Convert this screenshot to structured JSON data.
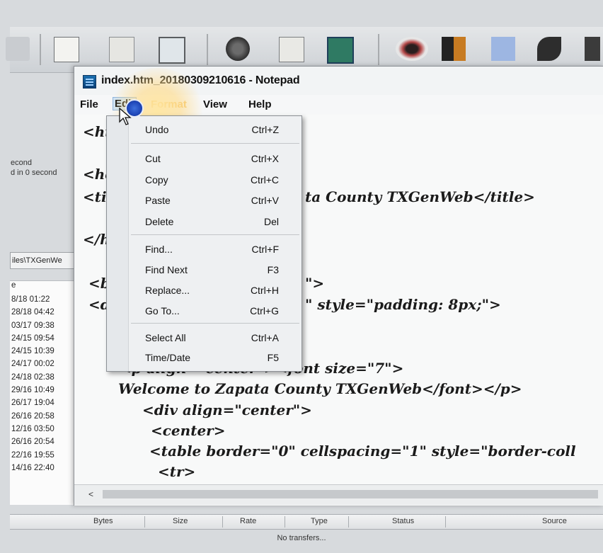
{
  "background_app": {
    "status_lines": [
      "econd",
      "d in 0 second"
    ],
    "path_text": "iles\\TXGenWe",
    "list_header": "e",
    "file_dates": [
      "8/18 01:22",
      "28/18 04:42",
      "03/17 09:38",
      "24/15 09:54",
      "24/15 10:39",
      "24/17 00:02",
      "24/18 02:38",
      "29/16 10:49",
      "26/17 19:04",
      "26/16 20:58",
      "12/16 03:50",
      "26/16 20:54",
      "22/16 19:55",
      "14/16 22:40"
    ],
    "transfer_columns": [
      "Bytes",
      "Size",
      "Rate",
      "Type",
      "Status",
      "Source"
    ],
    "no_transfers": "No transfers..."
  },
  "notepad": {
    "title": "index.htm_20180309210616 - Notepad",
    "menu": [
      "File",
      "Edit",
      "Format",
      "View",
      "Help"
    ],
    "code_lines": {
      "l1": "<ht",
      "l2": "<he",
      "l3a": "<ti",
      "l3b": "ta County TXGenWeb</title>",
      "l4": "</h",
      "l5a": "<bo",
      "l5b": "\">",
      "l6a": "<di",
      "l6b": "\" style=\"padding: 8px;\">",
      "l7": "<p align=\"center\"><font size=\"7\">",
      "l8": "Welcome to Zapata County TXGenWeb</font></p>",
      "l9": "<div align=\"center\">",
      "l10": "<center>",
      "l11": "<table border=\"0\" cellspacing=\"1\" style=\"border-coll",
      "l12": "<tr>"
    },
    "hscroll_left": "<"
  },
  "edit_menu": {
    "items": [
      {
        "label": "Undo",
        "shortcut": "Ctrl+Z"
      },
      {
        "label": "Cut",
        "shortcut": "Ctrl+X"
      },
      {
        "label": "Copy",
        "shortcut": "Ctrl+C"
      },
      {
        "label": "Paste",
        "shortcut": "Ctrl+V"
      },
      {
        "label": "Delete",
        "shortcut": "Del"
      },
      {
        "label": "Find...",
        "shortcut": "Ctrl+F"
      },
      {
        "label": "Find Next",
        "shortcut": "F3"
      },
      {
        "label": "Replace...",
        "shortcut": "Ctrl+H"
      },
      {
        "label": "Go To...",
        "shortcut": "Ctrl+G"
      },
      {
        "label": "Select All",
        "shortcut": "Ctrl+A"
      },
      {
        "label": "Time/Date",
        "shortcut": "F5"
      }
    ]
  },
  "colors": {
    "menu_highlight": "#cde3f7",
    "cursor_blue": "#1e46b8"
  }
}
